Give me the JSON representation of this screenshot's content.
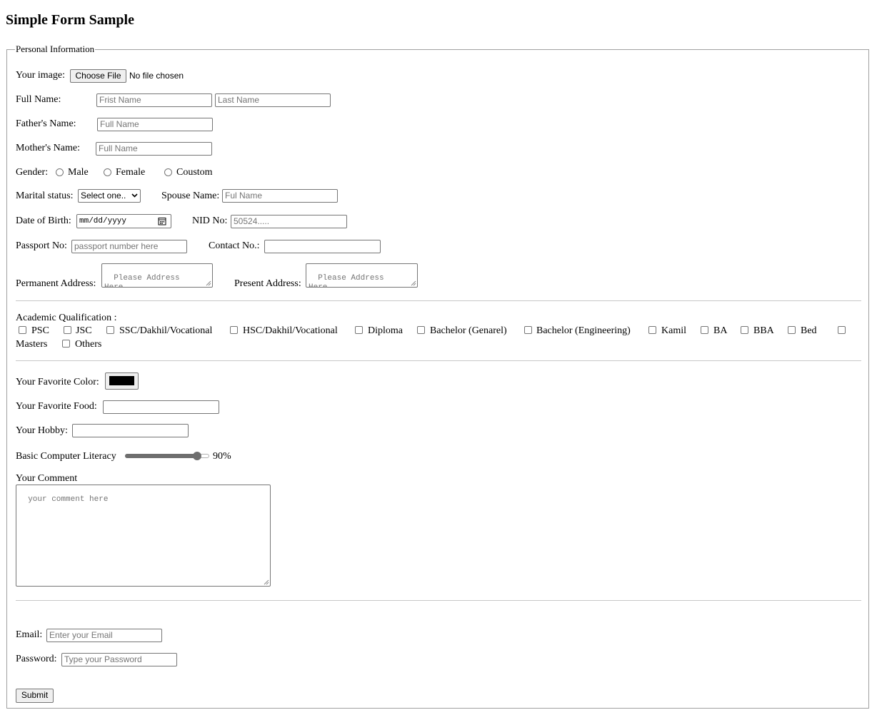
{
  "page_title": "Simple Form Sample",
  "personal": {
    "legend": "Personal Information",
    "image_label": "Your image:",
    "choose_file_label": "Choose File",
    "no_file_text": "No file chosen",
    "full_name_label": "Full Name:",
    "first_name_placeholder": "Frist Name",
    "last_name_placeholder": "Last Name",
    "father_label": "Father's Name:",
    "father_placeholder": "Full Name",
    "mother_label": "Mother's Name:",
    "mother_placeholder": "Full Name",
    "gender_label": "Gender:",
    "gender_options": [
      "Male",
      "Female",
      "Coustom"
    ],
    "marital_label": "Marital status:",
    "marital_selected": "Select one..",
    "spouse_label": "Spouse Name:",
    "spouse_placeholder": "Ful Name",
    "dob_label": "Date of Birth:",
    "dob_placeholder": "mm/dd/yyyy",
    "nid_label": "NID No:",
    "nid_placeholder": "50524.....",
    "passport_label": "Passport No:",
    "passport_placeholder": "passport number here",
    "contact_label": "Contact No.:",
    "contact_value": "",
    "permanent_label": "Permanent Address:",
    "permanent_placeholder": "Please Address Here....",
    "present_label": "Present Address:",
    "present_placeholder": "Please Address Here...."
  },
  "academic": {
    "label": "Academic Qualification :",
    "options": [
      "PSC",
      "JSC",
      "SSC/Dakhil/Vocational",
      "HSC/Dakhil/Vocational",
      "Diploma",
      "Bachelor (Genarel)",
      "Bachelor (Engineering)",
      "Kamil",
      "BA",
      "BBA",
      "Bed",
      "Masters",
      "Others"
    ]
  },
  "preferences": {
    "color_label": "Your Favorite Color:",
    "color_value": "#000000",
    "food_label": "Your Favorite Food:",
    "food_value": "",
    "hobby_label": "Your Hobby:",
    "hobby_value": "",
    "literacy_label": "Basic Computer Literacy",
    "literacy_value": 90,
    "literacy_text": "90%",
    "comment_label": "Your Comment",
    "comment_placeholder": "your comment here"
  },
  "account": {
    "email_label": "Email:",
    "email_placeholder": "Enter your Email",
    "password_label": "Password:",
    "password_placeholder": "Type your Password",
    "submit_label": "Submit"
  }
}
